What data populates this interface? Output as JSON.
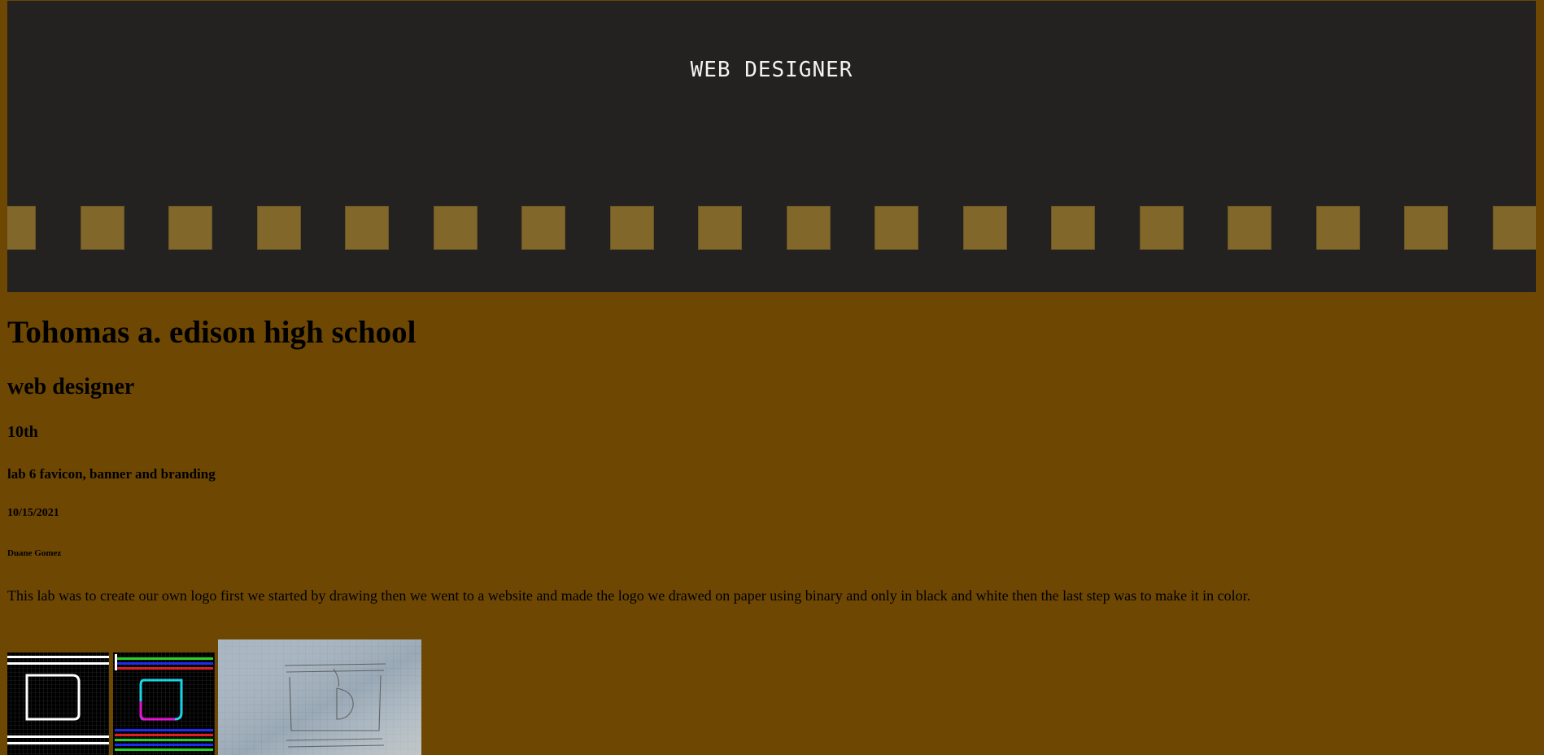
{
  "banner": {
    "subtitle": "WEB DESIGNER",
    "logo_icon": "dg-logo-mark",
    "square_color": "#82672b",
    "background_color": "#232220"
  },
  "headings": {
    "school": "Tohomas a. edison high school",
    "course": "web designer",
    "grade": "10th",
    "lab": "lab 6 favicon, banner and branding",
    "date": "10/15/2021",
    "author": "Duane Gomez"
  },
  "description": "This lab was to create our own logo first we started by drawing then we went to a website and made the logo we drawed on paper using binary and only in black and white then the last step was to make it in color.",
  "images": [
    {
      "icon": "bw-pixel-logo-image"
    },
    {
      "icon": "color-pixel-logo-image"
    },
    {
      "icon": "paper-sketch-photo"
    }
  ],
  "page_background": "#6e4703"
}
